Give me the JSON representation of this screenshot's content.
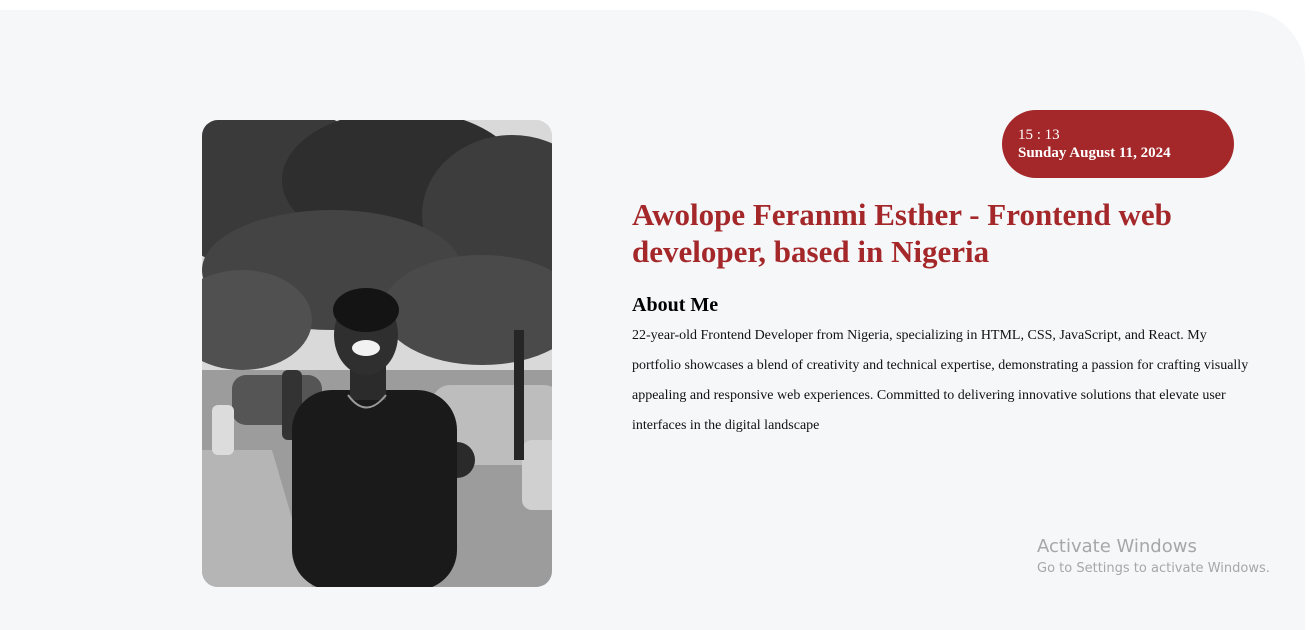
{
  "clock": {
    "time": "15 : 13",
    "date": "Sunday August 11, 2024"
  },
  "profile": {
    "headline": "Awolope Feranmi Esther - Frontend web developer, based in Nigeria",
    "about_title": "About Me",
    "about_text": "22-year-old Frontend Developer from Nigeria, specializing in HTML, CSS, JavaScript, and React. My portfolio showcases a blend of creativity and technical expertise, demonstrating a passion for crafting visually appealing and responsive web experiences. Committed to delivering innovative solutions that elevate user interfaces in the digital landscape"
  },
  "watermark": {
    "title": "Activate Windows",
    "subtitle": "Go to Settings to activate Windows."
  },
  "colors": {
    "accent": "#a4282a",
    "panel_background": "#f6f7f9"
  }
}
